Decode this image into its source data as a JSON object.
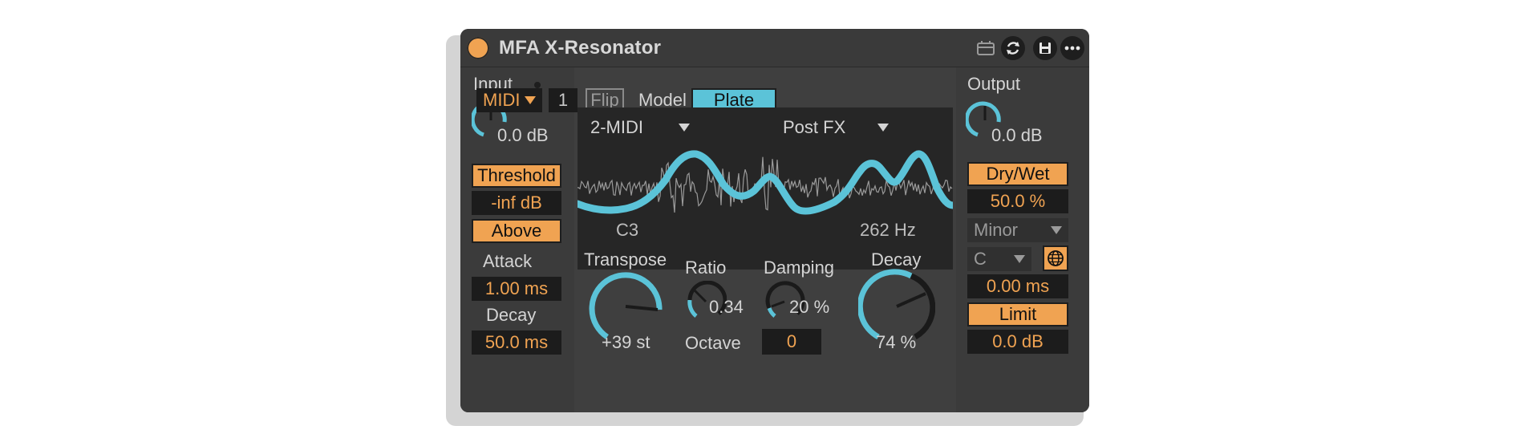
{
  "window": {
    "title": "MFA X-Resonator"
  },
  "titlebar_icons": [
    "clip-icon",
    "refresh-icon",
    "save-icon",
    "more-icon"
  ],
  "input": {
    "label": "Input",
    "gain": "0.0 dB",
    "threshold_label": "Threshold",
    "threshold_value": "-inf dB",
    "mode_label": "Above",
    "attack_label": "Attack",
    "attack_value": "1.00 ms",
    "decay_label": "Decay",
    "decay_value": "50.0 ms"
  },
  "top_bar": {
    "source": "MIDI",
    "channel": "1",
    "flip_label": "Flip",
    "model_label": "Model",
    "model_value": "Plate"
  },
  "scope": {
    "midi_input": "2-MIDI",
    "position": "Post FX",
    "note": "C3",
    "frequency": "262 Hz"
  },
  "controls": {
    "transpose_label": "Transpose",
    "transpose_value": "+39 st",
    "ratio_label": "Ratio",
    "ratio_value": "0.34",
    "damping_label": "Damping",
    "damping_value": "20 %",
    "octave_label": "Octave",
    "octave_value": "0",
    "decay_label": "Decay",
    "decay_value": "74 %"
  },
  "output": {
    "label": "Output",
    "gain": "0.0 dB",
    "drywet_label": "Dry/Wet",
    "drywet_value": "50.0 %",
    "scale": "Minor",
    "key": "C",
    "time_value": "0.00 ms",
    "limit_label": "Limit",
    "limit_value": "0.0 dB"
  },
  "colors": {
    "accent_orange": "#f0a352",
    "accent_blue": "#5bc3d8",
    "panel": "#363636",
    "field_bg": "#1c1c1c"
  }
}
